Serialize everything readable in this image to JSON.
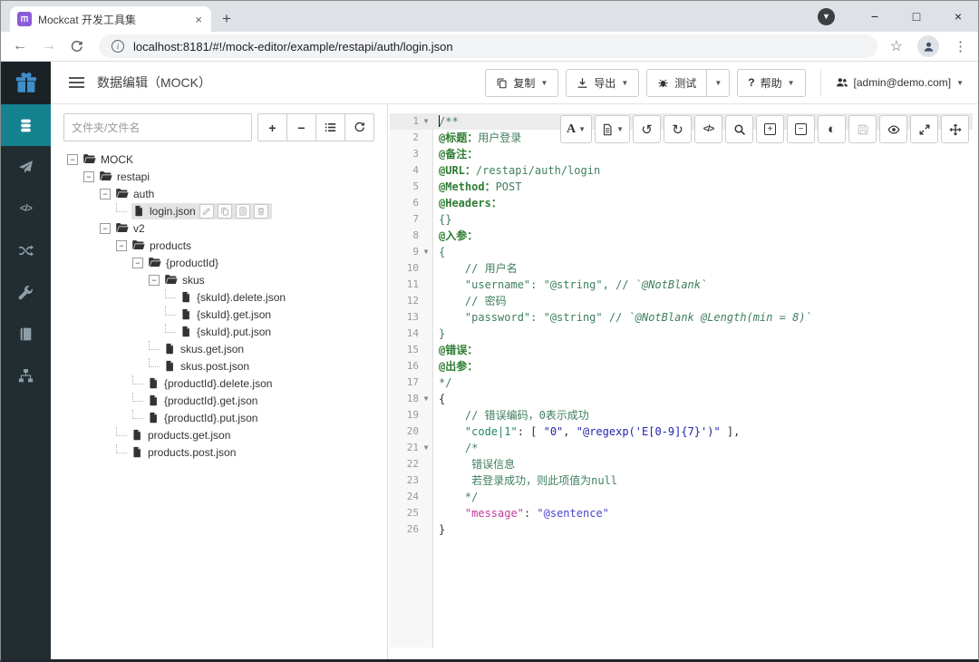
{
  "browser": {
    "tab": {
      "title": "Mockcat 开发工具集",
      "close": "×"
    },
    "new_tab": "+",
    "url": "localhost:8181/#!/mock-editor/example/restapi/auth/login.json",
    "window_controls": {
      "minimize": "−",
      "maximize": "□",
      "close": "×"
    },
    "menu_dots": "⋮",
    "star": "☆",
    "back": "←",
    "forward": "→"
  },
  "header": {
    "title": "数据编辑（MOCK）",
    "buttons": {
      "copy": "复制",
      "export": "导出",
      "test": "测试",
      "help_q": "?",
      "help": "帮助"
    },
    "user": "[admin@demo.com]"
  },
  "sidebar": {
    "items": [
      {
        "icon": "database",
        "active": true
      },
      {
        "icon": "send",
        "active": false
      },
      {
        "icon": "code",
        "active": false
      },
      {
        "icon": "shuffle",
        "active": false
      },
      {
        "icon": "wrench",
        "active": false
      },
      {
        "icon": "book",
        "active": false
      },
      {
        "icon": "sitemap",
        "active": false
      }
    ]
  },
  "tree_panel": {
    "search_placeholder": "文件夹/文件名",
    "toolbar": [
      "add",
      "remove",
      "list",
      "refresh"
    ],
    "items": [
      {
        "label": "MOCK",
        "type": "folder",
        "depth": 0
      },
      {
        "label": "restapi",
        "type": "folder",
        "depth": 1
      },
      {
        "label": "auth",
        "type": "folder",
        "depth": 2
      },
      {
        "label": "login.json",
        "type": "file",
        "depth": 3,
        "selected": true,
        "actions": [
          "edit",
          "copy",
          "detail",
          "delete"
        ]
      },
      {
        "label": "v2",
        "type": "folder",
        "depth": 2
      },
      {
        "label": "products",
        "type": "folder",
        "depth": 3
      },
      {
        "label": "{productId}",
        "type": "folder",
        "depth": 4
      },
      {
        "label": "skus",
        "type": "folder",
        "depth": 5
      },
      {
        "label": "{skuId}.delete.json",
        "type": "file",
        "depth": 6
      },
      {
        "label": "{skuId}.get.json",
        "type": "file",
        "depth": 6
      },
      {
        "label": "{skuId}.put.json",
        "type": "file",
        "depth": 6
      },
      {
        "label": "skus.get.json",
        "type": "file",
        "depth": 5
      },
      {
        "label": "skus.post.json",
        "type": "file",
        "depth": 5
      },
      {
        "label": "{productId}.delete.json",
        "type": "file",
        "depth": 4
      },
      {
        "label": "{productId}.get.json",
        "type": "file",
        "depth": 4
      },
      {
        "label": "{productId}.put.json",
        "type": "file",
        "depth": 4
      },
      {
        "label": "products.get.json",
        "type": "file",
        "depth": 3
      },
      {
        "label": "products.post.json",
        "type": "file",
        "depth": 3
      }
    ]
  },
  "editor": {
    "toolbar": [
      {
        "icon": "font",
        "caret": true
      },
      {
        "icon": "template",
        "caret": true
      },
      {
        "icon": "undo"
      },
      {
        "icon": "redo"
      },
      {
        "icon": "format"
      },
      {
        "icon": "search"
      },
      {
        "icon": "unfold"
      },
      {
        "icon": "fold"
      },
      {
        "icon": "theme"
      },
      {
        "icon": "save",
        "disabled": true
      },
      {
        "icon": "preview"
      },
      {
        "icon": "expand"
      },
      {
        "icon": "move"
      }
    ],
    "lines": [
      {
        "n": 1,
        "fold": true,
        "active": true,
        "cursor": true,
        "tokens": [
          {
            "t": "/**",
            "s": "comment"
          }
        ]
      },
      {
        "n": 2,
        "tokens": [
          {
            "t": "@标题：",
            "s": "tag"
          },
          {
            "t": "用户登录",
            "s": "comment"
          }
        ]
      },
      {
        "n": 3,
        "tokens": [
          {
            "t": "@备注：",
            "s": "tag"
          }
        ]
      },
      {
        "n": 4,
        "tokens": [
          {
            "t": "@URL：",
            "s": "tag"
          },
          {
            "t": "/restapi/auth/login",
            "s": "comment"
          }
        ]
      },
      {
        "n": 5,
        "tokens": [
          {
            "t": "@Method：",
            "s": "tag"
          },
          {
            "t": "POST",
            "s": "comment"
          }
        ]
      },
      {
        "n": 6,
        "tokens": [
          {
            "t": "@Headers：",
            "s": "tag"
          }
        ]
      },
      {
        "n": 7,
        "tokens": [
          {
            "t": "{}",
            "s": "comment"
          }
        ]
      },
      {
        "n": 8,
        "tokens": [
          {
            "t": "@入参：",
            "s": "tag"
          }
        ]
      },
      {
        "n": 9,
        "fold": true,
        "tokens": [
          {
            "t": "{",
            "s": "comment"
          }
        ]
      },
      {
        "n": 10,
        "tokens": [
          {
            "t": "    // 用户名",
            "s": "comment"
          }
        ]
      },
      {
        "n": 11,
        "tokens": [
          {
            "t": "    \"username\": \"@string\", // ",
            "s": "comment"
          },
          {
            "t": "`@NotBlank`",
            "s": "comment-em"
          }
        ]
      },
      {
        "n": 12,
        "tokens": [
          {
            "t": "    // 密码",
            "s": "comment"
          }
        ]
      },
      {
        "n": 13,
        "tokens": [
          {
            "t": "    \"password\": \"@string\" // ",
            "s": "comment"
          },
          {
            "t": "`@NotBlank @Length(min = 8)`",
            "s": "comment-em"
          }
        ]
      },
      {
        "n": 14,
        "tokens": [
          {
            "t": "}",
            "s": "comment"
          }
        ]
      },
      {
        "n": 15,
        "tokens": [
          {
            "t": "@错误：",
            "s": "tag"
          }
        ]
      },
      {
        "n": 16,
        "tokens": [
          {
            "t": "@出参：",
            "s": "tag"
          }
        ]
      },
      {
        "n": 17,
        "tokens": [
          {
            "t": "*/",
            "s": "comment"
          }
        ]
      },
      {
        "n": 18,
        "fold": true,
        "tokens": [
          {
            "t": "{",
            "s": "plain"
          }
        ]
      },
      {
        "n": 19,
        "tokens": [
          {
            "t": "    // 错误编码，0表示成功",
            "s": "comment"
          }
        ]
      },
      {
        "n": 20,
        "tokens": [
          {
            "t": "    ",
            "s": "plain"
          },
          {
            "t": "\"code|1\"",
            "s": "keyrule"
          },
          {
            "t": ": [ ",
            "s": "plain"
          },
          {
            "t": "\"0\"",
            "s": "string"
          },
          {
            "t": ", ",
            "s": "plain"
          },
          {
            "t": "\"@regexp('E[0-9]{7}')\"",
            "s": "string"
          },
          {
            "t": " ],",
            "s": "plain"
          }
        ]
      },
      {
        "n": 21,
        "fold": true,
        "tokens": [
          {
            "t": "    /*",
            "s": "comment"
          }
        ]
      },
      {
        "n": 22,
        "tokens": [
          {
            "t": "     错误信息",
            "s": "comment"
          }
        ]
      },
      {
        "n": 23,
        "tokens": [
          {
            "t": "     若登录成功，则此项值为null",
            "s": "comment"
          }
        ]
      },
      {
        "n": 24,
        "tokens": [
          {
            "t": "    */",
            "s": "comment"
          }
        ]
      },
      {
        "n": 25,
        "tokens": [
          {
            "t": "    ",
            "s": "plain"
          },
          {
            "t": "\"message\"",
            "s": "key"
          },
          {
            "t": ": ",
            "s": "plain"
          },
          {
            "t": "\"@sentence\"",
            "s": "string2"
          }
        ]
      },
      {
        "n": 26,
        "tokens": [
          {
            "t": "}",
            "s": "plain"
          }
        ]
      }
    ]
  }
}
